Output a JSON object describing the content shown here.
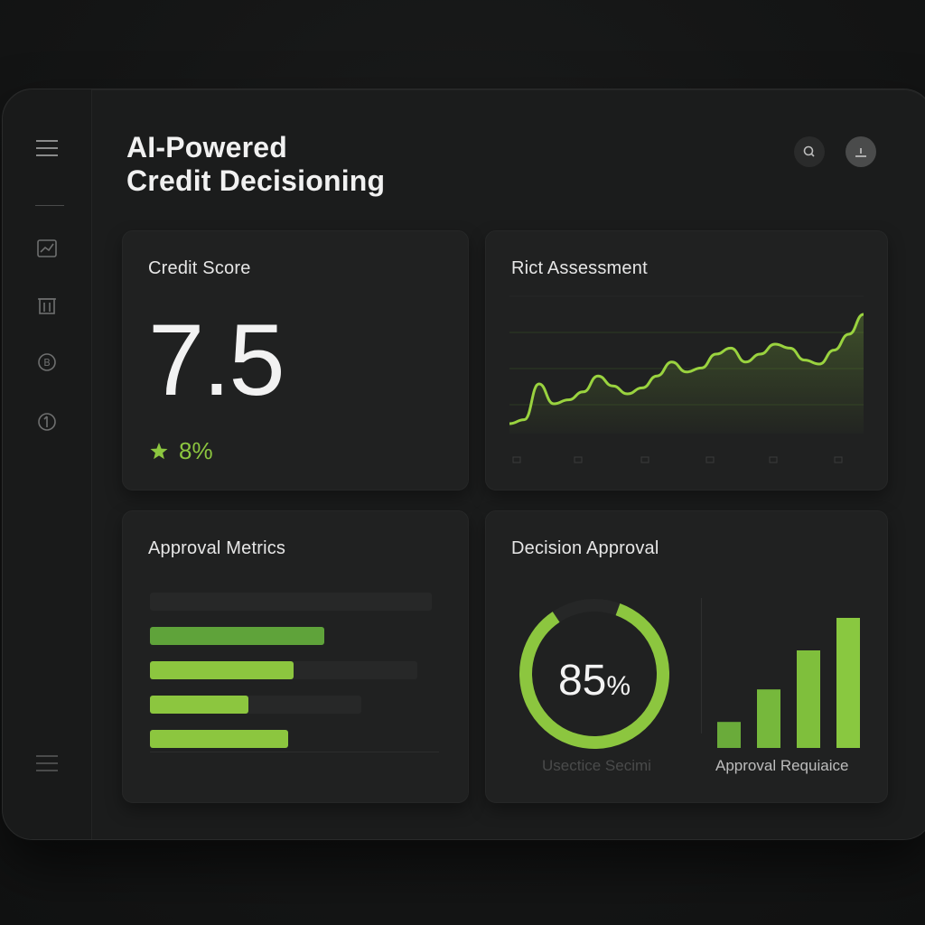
{
  "header": {
    "title_line1": "AI-Powered",
    "title_line2": "Credit Decisioning"
  },
  "top_actions": {
    "search_icon": "search-icon",
    "user_icon": "user-icon"
  },
  "sidebar": {
    "icons": [
      "menu-icon",
      "chart-icon",
      "building-icon",
      "coin-icon",
      "currency-icon",
      "settings-menu-icon"
    ]
  },
  "credit_score": {
    "title": "Credit Score",
    "value": "7.5",
    "change": "8%"
  },
  "risk": {
    "title": "Rict Assessment"
  },
  "approval_metrics": {
    "title": "Approval Metrics",
    "bars": [
      {
        "track": 1.0,
        "fill": 0.0
      },
      {
        "track": 0.62,
        "fill": 0.62
      },
      {
        "track": 0.95,
        "fill": 0.51
      },
      {
        "track": 0.75,
        "fill": 0.35
      },
      {
        "track": 0.49,
        "fill": 0.49
      }
    ]
  },
  "decision": {
    "title": "Decision Approval",
    "percent": "85",
    "percent_sign": "%",
    "percent_value": 0.85,
    "left_caption": "Usectice Secimi",
    "right_caption": "Approval Requiaice",
    "bars": [
      0.2,
      0.45,
      0.75,
      1.0
    ]
  },
  "chart_data": [
    {
      "type": "line",
      "title": "Rict Assessment",
      "x": [
        0,
        1,
        2,
        3,
        4,
        5,
        6,
        7,
        8,
        9,
        10,
        11,
        12,
        13,
        14,
        15,
        16,
        17,
        18,
        19,
        20,
        21,
        22,
        23,
        24
      ],
      "y": [
        10,
        14,
        50,
        30,
        34,
        42,
        58,
        48,
        40,
        46,
        58,
        72,
        62,
        66,
        80,
        86,
        72,
        80,
        90,
        86,
        74,
        70,
        84,
        100,
        120
      ],
      "ylim": [
        0,
        140
      ],
      "grid": true
    },
    {
      "type": "bar",
      "title": "Decision Approval",
      "categories": [
        "1",
        "2",
        "3",
        "4"
      ],
      "values": [
        20,
        45,
        75,
        100
      ]
    }
  ],
  "colors": {
    "accent": "#8cc63f",
    "accent_dark": "#5fa33a",
    "card": "#202121",
    "background": "#151616"
  }
}
